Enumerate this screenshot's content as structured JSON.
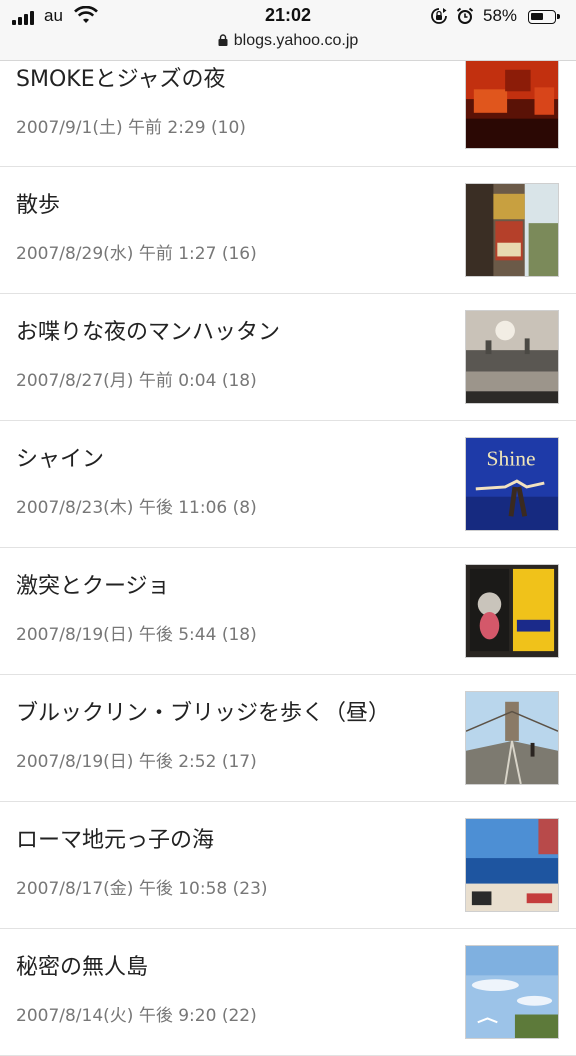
{
  "status_bar": {
    "carrier": "au",
    "time": "21:02",
    "battery_percent": "58%",
    "battery_level": 0.58,
    "url": "blogs.yahoo.co.jp"
  },
  "posts": [
    {
      "title": "SMOKEとジャズの夜",
      "meta": "2007/9/1(土) 午前 2:29 (10)"
    },
    {
      "title": "散歩",
      "meta": "2007/8/29(水) 午前 1:27 (16)"
    },
    {
      "title": "お喋りな夜のマンハッタン",
      "meta": "2007/8/27(月) 午前 0:04 (18)"
    },
    {
      "title": "シャイン",
      "meta": "2007/8/23(木) 午後 11:06 (8)",
      "thumb_text": "Shine"
    },
    {
      "title": "激突とクージョ",
      "meta": "2007/8/19(日) 午後 5:44 (18)"
    },
    {
      "title": "ブルックリン・ブリッジを歩く（昼）",
      "meta": "2007/8/19(日) 午後 2:52 (17)"
    },
    {
      "title": "ローマ地元っ子の海",
      "meta": "2007/8/17(金) 午後 10:58 (23)"
    },
    {
      "title": "秘密の無人島",
      "meta": "2007/8/14(火) 午後 9:20 (22)"
    }
  ]
}
